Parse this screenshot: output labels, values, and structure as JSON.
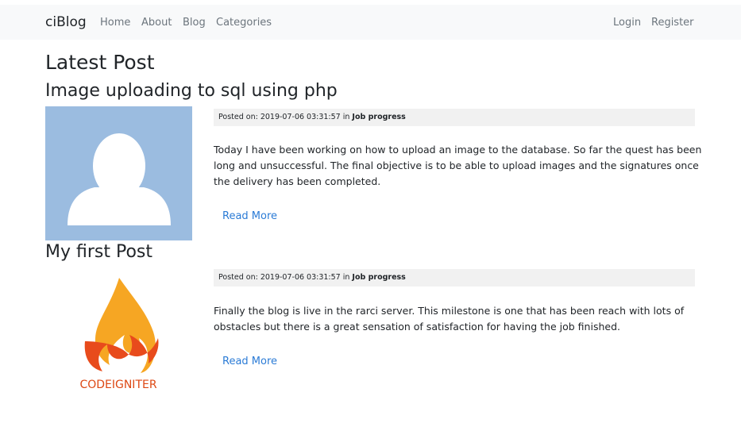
{
  "navbar": {
    "brand": "ciBlog",
    "left_links": [
      "Home",
      "About",
      "Blog",
      "Categories"
    ],
    "right_links": [
      "Login",
      "Register"
    ]
  },
  "page": {
    "heading": "Latest Post"
  },
  "posts": [
    {
      "title": "Image uploading to sql using php",
      "meta_prefix": "Posted on: 2019-07-06 03:31:57 in ",
      "category": "Job progress",
      "body": "Today I have been working on how to upload an image to the database. So far the quest has been long and unsuccessful. The final objective is to be able to upload images and the signatures once the delivery has been completed.",
      "read_more": "Read More",
      "image_icon": "user-avatar-icon"
    },
    {
      "title": "My first Post",
      "meta_prefix": "Posted on: 2019-07-06 03:31:57 in ",
      "category": "Job progress",
      "body": "Finally the blog is live in the rarci server. This milestone is one that has been reach with lots of obstacles but there is a great sensation of satisfaction for having the job finished.",
      "read_more": "Read More",
      "image_icon": "codeigniter-logo",
      "logo_text": "CODEIGNITER"
    }
  ],
  "colors": {
    "navbar_bg": "#f8f9fa",
    "link": "#2b7bd6",
    "meta_bg": "#f1f1f1",
    "avatar_bg": "#9bbce0",
    "logo_orange": "#dd4814"
  }
}
